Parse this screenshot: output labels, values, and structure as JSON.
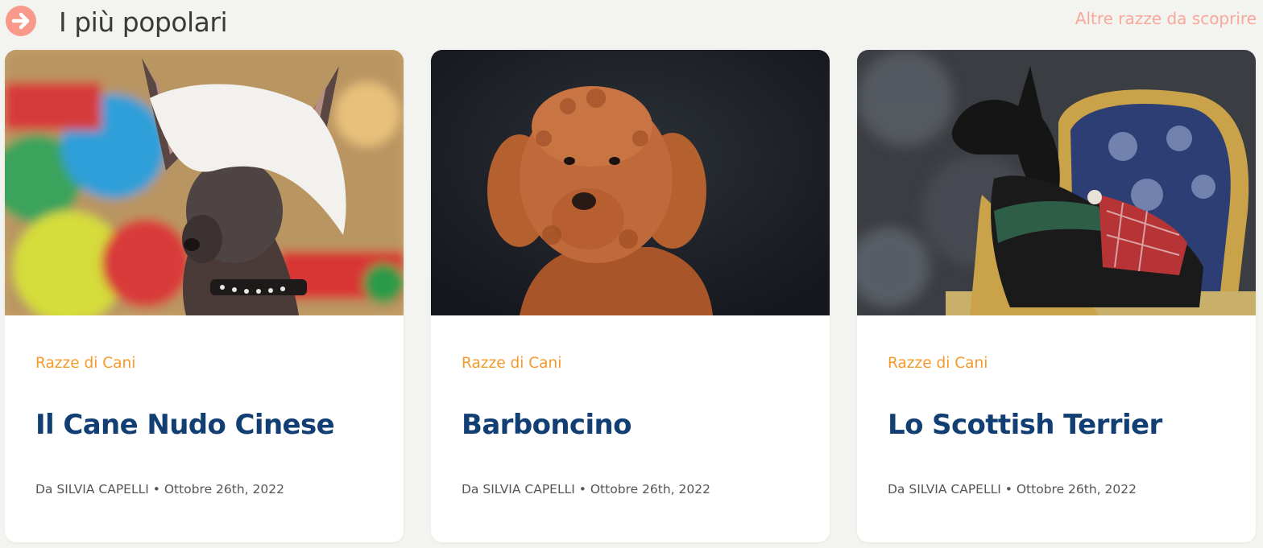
{
  "header": {
    "title": "I più popolari",
    "more_link": "Altre razze da scoprire",
    "icon": "arrow-right-circle-icon",
    "accent_color": "#f8998a"
  },
  "cards": [
    {
      "category": "Razze di Cani",
      "title": "Il Cane Nudo Cinese",
      "author": "Da SILVIA CAPELLI",
      "separator": "•",
      "date": "Ottobre 26th, 2022",
      "image_subject": "chinese-crested-dog-photo"
    },
    {
      "category": "Razze di Cani",
      "title": "Barboncino",
      "author": "Da SILVIA CAPELLI",
      "separator": "•",
      "date": "Ottobre 26th, 2022",
      "image_subject": "poodle-photo"
    },
    {
      "category": "Razze di Cani",
      "title": "Lo Scottish Terrier",
      "author": "Da SILVIA CAPELLI",
      "separator": "•",
      "date": "Ottobre 26th, 2022",
      "image_subject": "scottish-terrier-photo"
    }
  ],
  "colors": {
    "category": "#f39a2c",
    "title": "#113f73",
    "meta": "#555555",
    "background": "#f3f3f0"
  }
}
